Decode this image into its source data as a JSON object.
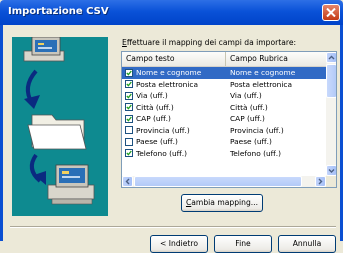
{
  "window": {
    "title": "Importazione CSV",
    "close_icon": "close-icon"
  },
  "instruction": {
    "underlined": "E",
    "text": "ffettuare il mapping dei campi da importare:"
  },
  "columns": [
    "Campo testo",
    "Campo Rubrica"
  ],
  "rows": [
    {
      "checked": true,
      "field": "Nome e cognome",
      "mapped": "Nome e cognome",
      "selected": true
    },
    {
      "checked": true,
      "field": "Posta elettronica",
      "mapped": "Posta elettronica",
      "selected": false
    },
    {
      "checked": true,
      "field": "Via (uff.)",
      "mapped": "Via (uff.)",
      "selected": false
    },
    {
      "checked": true,
      "field": "Città (uff.)",
      "mapped": "Città (uff.)",
      "selected": false
    },
    {
      "checked": true,
      "field": "CAP (uff.)",
      "mapped": "CAP (uff.)",
      "selected": false
    },
    {
      "checked": false,
      "field": "Provincia (uff.)",
      "mapped": "Provincia (uff.)",
      "selected": false
    },
    {
      "checked": false,
      "field": "Paese (uff.)",
      "mapped": "Paese (uff.)",
      "selected": false
    },
    {
      "checked": true,
      "field": "Telefono (uff.)",
      "mapped": "Telefono (uff.)",
      "selected": false
    }
  ],
  "buttons": {
    "cambia": {
      "underlined": "C",
      "rest": "ambia mapping..."
    },
    "indietro": "< Indietro",
    "fine": "Fine",
    "annulla": "Annulla"
  },
  "colors": {
    "titlebar": "#0A52D8",
    "selection": "#316AC5",
    "illustration_bg": "#0E8A90"
  }
}
